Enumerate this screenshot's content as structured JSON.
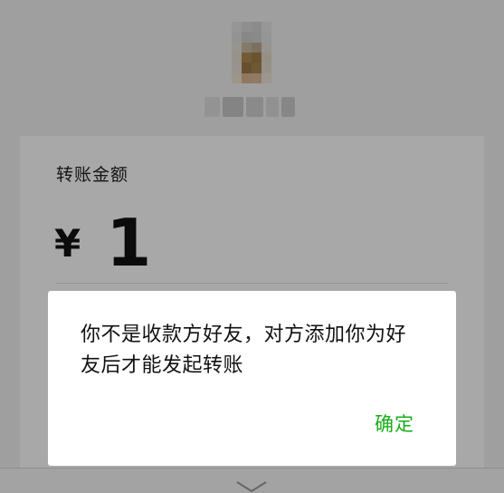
{
  "transfer": {
    "amount_label": "转账金额",
    "currency_symbol": "¥",
    "amount": "1"
  },
  "dialog": {
    "message": "你不是收款方好友，对方添加你为好友后才能发起转账",
    "confirm_label": "确定"
  },
  "colors": {
    "accent_green": "#1aad19",
    "overlay": "rgba(0,0,0,0.34)",
    "card_background": "#ffffff"
  }
}
